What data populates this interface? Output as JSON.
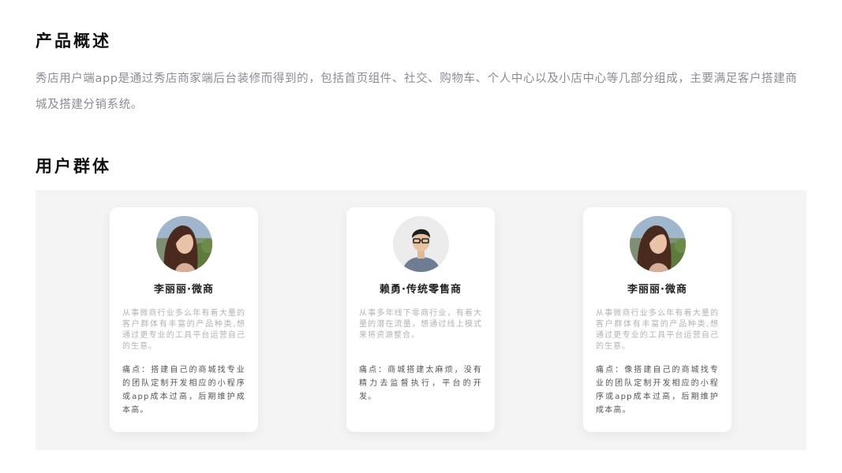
{
  "overview": {
    "title": "产品概述",
    "text": "秀店用户端app是通过秀店商家端后台装修而得到的，包括首页组件、社交、购物车、个人中心以及小店中心等几部分组成，主要满足客户搭建商城及搭建分销系统。"
  },
  "users": {
    "title": "用户群体",
    "cards": [
      {
        "avatar": "female-portrait",
        "name": "李丽丽·微商",
        "desc": "从事微商行业多么年有着大量的客户群体有丰富的产品种类,想通过更专业的工具平台运营自己的生意。",
        "pain": "痛点：搭建自己的商城找专业的团队定制开发相应的小程序或app成本过高，后期维护成本高。"
      },
      {
        "avatar": "male-portrait",
        "name": "赖勇·传统零售商",
        "desc": "从事多年线下零商行业，有着大量的潜在流量，想通过线上模式来将资源整合。",
        "pain": "痛点：商城搭建太麻烦，没有精力去监督执行，平台的开发。"
      },
      {
        "avatar": "female-portrait",
        "name": "李丽丽·微商",
        "desc": "从事微商行业多么年有着大量的客户群体有丰富的产品种类,想通过更专业的工具平台运营自己的生意。",
        "pain": "痛点：像搭建自己的商城找专业的团队定制开发相应的小程序或app成本过高，后期维护成本高。"
      }
    ]
  }
}
